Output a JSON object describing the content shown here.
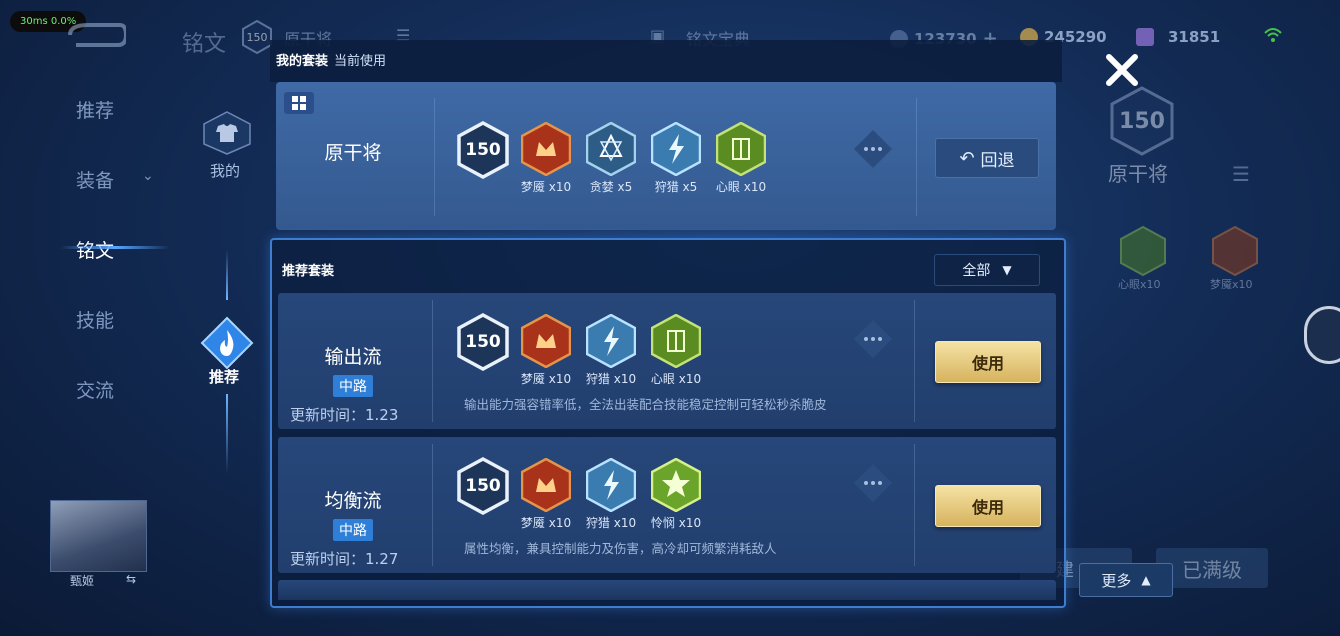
{
  "perf": "30ms  0.0%",
  "header": {
    "title": "铭文",
    "level": "150",
    "current_set": "原干将",
    "shop": "铭文宝典",
    "resources": [
      "123730",
      "245290",
      "31851"
    ]
  },
  "sidebar": {
    "items": [
      {
        "label": "推荐"
      },
      {
        "label": "装备"
      },
      {
        "label": "铭文"
      },
      {
        "label": "技能"
      },
      {
        "label": "交流"
      }
    ],
    "mine_label": "我的",
    "recommend_label": "推荐",
    "hero_name": "甄姬"
  },
  "right_side": {
    "level": "150",
    "set_name": "原干将",
    "rune_labels": [
      "心眼x10",
      "梦魇x10"
    ],
    "upgrade_label": "已满级",
    "build_label": "建"
  },
  "mine": {
    "heading": "我的套装",
    "subheading": "当前使用",
    "name": "原干将",
    "level": "150",
    "runes": [
      {
        "label": "梦魇 x10",
        "icon": "red-rune-icon"
      },
      {
        "label": "贪婪 x5",
        "icon": "blue-star-rune-icon"
      },
      {
        "label": "狩猎 x5",
        "icon": "blue-lightning-rune-icon"
      },
      {
        "label": "心眼 x10",
        "icon": "green-rune-icon"
      }
    ],
    "back_label": "回退"
  },
  "recommend": {
    "heading": "推荐套装",
    "filter": "全部",
    "sets": [
      {
        "name": "输出流",
        "lane": "中路",
        "update": "更新时间：1.23",
        "level": "150",
        "runes": [
          {
            "label": "梦魇 x10",
            "icon": "red-rune-icon"
          },
          {
            "label": "狩猎 x10",
            "icon": "blue-lightning-rune-icon"
          },
          {
            "label": "心眼 x10",
            "icon": "green-rune-icon"
          }
        ],
        "desc": "输出能力强容错率低，全法出装配合技能稳定控制可轻松秒杀脆皮",
        "use_label": "使用"
      },
      {
        "name": "均衡流",
        "lane": "中路",
        "update": "更新时间：1.27",
        "level": "150",
        "runes": [
          {
            "label": "梦魇 x10",
            "icon": "red-rune-icon"
          },
          {
            "label": "狩猎 x10",
            "icon": "blue-lightning-rune-icon"
          },
          {
            "label": "怜悯 x10",
            "icon": "green-star-rune-icon"
          }
        ],
        "desc": "属性均衡，兼具控制能力及伤害，高冷却可频繁消耗敌人",
        "use_label": "使用"
      }
    ]
  },
  "more_label": "更多",
  "colors": {
    "red": "#c7401c",
    "blue": "#5aa6d6",
    "green": "#6aa42a",
    "gold": "#e3c275"
  }
}
